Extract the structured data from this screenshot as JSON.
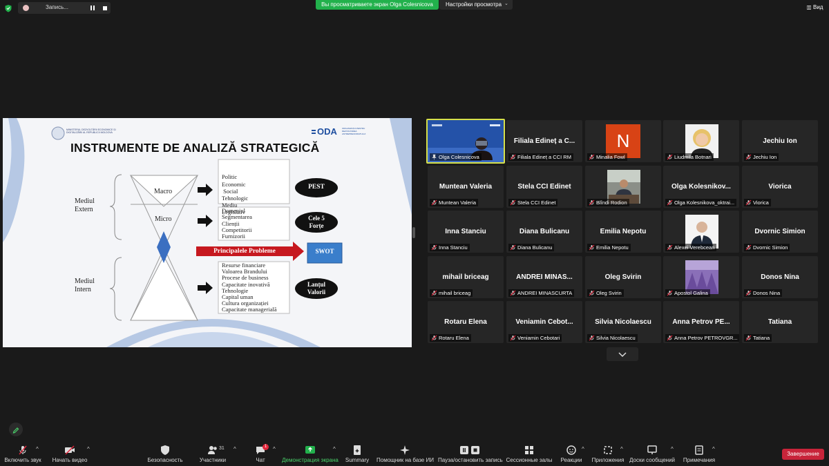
{
  "topbar": {
    "recording_label": "Запись...",
    "viewing_banner": "Вы просматриваете экран Olga Colesnicova",
    "view_options": "Настройки просмотра",
    "view_label": "Вид"
  },
  "slide": {
    "ministry_text": "MINISTERUL DEZVOLTĂRII ECONOMICE ȘI DIGITALIZĂRII AL REPUBLICII MOLDOVA",
    "oda_logo": "ODA",
    "oda_subtext": "ORGANIZAȚIA PENTRU DEZVOLTAREA ANTREPRENORIATULUI",
    "title": "INSTRUMENTE DE ANALIZĂ STRATEGICĂ",
    "mediul_extern": [
      "Mediul",
      "Extern"
    ],
    "mediul_intern": [
      "Mediul",
      "Intern"
    ],
    "macro": "Macro",
    "micro": "Micro",
    "macro_list": [
      "Politic",
      "Economic",
      " Social",
      "Tehnologic",
      "Mediu",
      "Legislativ"
    ],
    "micro_list": [
      "Domeniul",
      "Segmentarea",
      "Clienții",
      "Competitorii",
      "Furnizorii"
    ],
    "intern_list": [
      "Resurse financiare",
      "Valoarea Brandului",
      "Procese de business",
      "Capacitate inovativă",
      "Tehnologie",
      "Capital uman",
      "Cultura organizației",
      "Capacitate managerială"
    ],
    "pest": "PEST",
    "cele5": [
      "Cele 5",
      "Forțe"
    ],
    "principale": "Principalele Probleme",
    "swot": "SWOT",
    "lantul": [
      "Lanțul",
      "Valorii"
    ]
  },
  "participants": [
    {
      "name": "Olga Colesnicova",
      "label": "Olga Colesnicova",
      "kind": "video",
      "active": true
    },
    {
      "name": "Filiala Edineț a C...",
      "label": "Filiala Edineț a CCI RM",
      "kind": "name"
    },
    {
      "name": "N",
      "label": "Minalia Fowl",
      "kind": "letter"
    },
    {
      "name": "",
      "label": "Liudmila Botnari",
      "kind": "photo-woman"
    },
    {
      "name": "Jechiu Ion",
      "label": "Jechiu Ion",
      "kind": "name"
    },
    {
      "name": "Muntean Valeria",
      "label": "Muntean Valeria",
      "kind": "name"
    },
    {
      "name": "Stela CCI Edinet",
      "label": "Stela CCI Edinet",
      "kind": "name"
    },
    {
      "name": "",
      "label": "Blîndi Rodion",
      "kind": "photo-office"
    },
    {
      "name": "Olga  Kolesnikov...",
      "label": "Olga Kolesnikova_oktrai...",
      "kind": "name"
    },
    {
      "name": "Viorica",
      "label": "Viorica",
      "kind": "name"
    },
    {
      "name": "Inna Stanciu",
      "label": "Inna Stanciu",
      "kind": "name"
    },
    {
      "name": "Diana Bulicanu",
      "label": "Diana Bulicanu",
      "kind": "name"
    },
    {
      "name": "Emilia Nepotu",
      "label": "Emilia Nepotu",
      "kind": "name"
    },
    {
      "name": "",
      "label": "Alexei Verebcean",
      "kind": "photo-man"
    },
    {
      "name": "Dvornic Simion",
      "label": "Dvornic Simion",
      "kind": "name"
    },
    {
      "name": "mihail briceag",
      "label": "mihail briceag",
      "kind": "name"
    },
    {
      "name": "ANDREI  MINAS...",
      "label": "ANDREI MINASCURTA",
      "kind": "name"
    },
    {
      "name": "Oleg Svirin",
      "label": "Oleg Svirin",
      "kind": "name"
    },
    {
      "name": "",
      "label": "Apostol Galina",
      "kind": "photo-lavender"
    },
    {
      "name": "Donos Nina",
      "label": "Donos Nina",
      "kind": "name"
    },
    {
      "name": "Rotaru Elena",
      "label": "Rotaru Elena",
      "kind": "name"
    },
    {
      "name": "Veniamin  Cebot...",
      "label": "Veniamin Cebotari",
      "kind": "name"
    },
    {
      "name": "Silvia Nicolaescu",
      "label": "Silvia Nicolaescu",
      "kind": "name"
    },
    {
      "name": "Anna Petrov  PE...",
      "label": "Anna Petrov PETROVGR...",
      "kind": "name"
    },
    {
      "name": "Tatiana",
      "label": "Tatiana",
      "kind": "name"
    }
  ],
  "toolbar": {
    "unmute": "Включить звук",
    "start_video": "Начать видео",
    "security": "Безопасность",
    "participants": "Участники",
    "participants_count": "31",
    "chat": "Чат",
    "chat_badge": "1",
    "share_screen": "Демонстрация экрана",
    "summary": "Summary",
    "ai_assistant": "Помощник на базе ИИ",
    "pause_record": "Пауза/остановить запись",
    "breakout": "Сессионные залы",
    "reactions": "Реакции",
    "apps": "Приложения",
    "whiteboards": "Доски сообщений",
    "notes": "Примечания",
    "end": "Завершение"
  },
  "colors": {
    "accent_green": "#22b14c",
    "end_red": "#c8243a",
    "active_border": "#d6e04a",
    "mute_red": "#e0263b"
  }
}
